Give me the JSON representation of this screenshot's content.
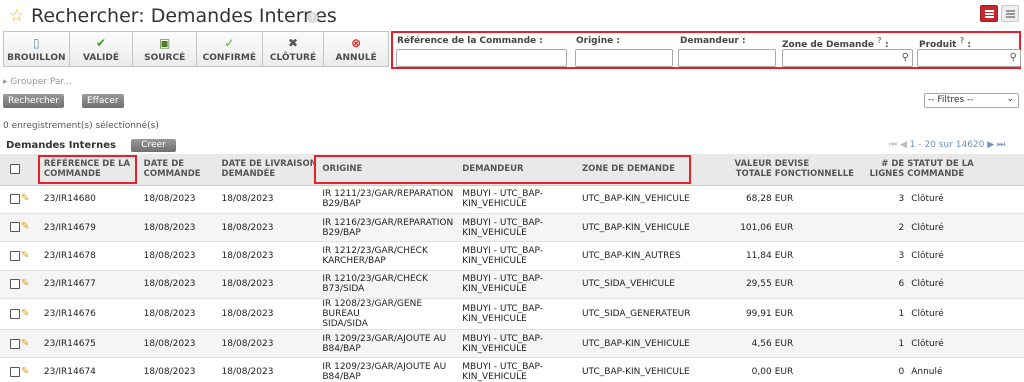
{
  "header": {
    "title": "Rechercher: Demandes Internes"
  },
  "states": [
    {
      "label": "BROUILLON",
      "icon": "draft-icon",
      "glyph": "▯",
      "color": "#6b8cb8"
    },
    {
      "label": "VALIDÉ",
      "icon": "check-circle-icon",
      "glyph": "✔",
      "color": "#3f9a2a"
    },
    {
      "label": "SOURCÉ",
      "icon": "source-icon",
      "glyph": "▣",
      "color": "#4a7d2a"
    },
    {
      "label": "CONFIRMÉ",
      "icon": "checkmark-icon",
      "glyph": "✓",
      "color": "#4caf28"
    },
    {
      "label": "CLÔTURÉ",
      "icon": "close-x-icon",
      "glyph": "✖",
      "color": "#555555"
    },
    {
      "label": "ANNULÉ",
      "icon": "cancel-circle-icon",
      "glyph": "⊗",
      "color": "#d32323"
    }
  ],
  "filters": {
    "reference_label": "Référence de la Commande :",
    "origin_label": "Origine :",
    "requester_label": "Demandeur :",
    "zone_label": "Zone de Demande",
    "product_label": "Produit",
    "help_mark": "?",
    "colon": ":",
    "reference_value": "",
    "origin_value": "",
    "requester_value": "",
    "zone_value": "",
    "product_value": ""
  },
  "toolbar": {
    "group_by": "Grouper Par...",
    "search_button": "Rechercher",
    "clear_button": "Effacer",
    "filters_select": "-- Filtres --",
    "selected_count": "0 enregistrement(s) sélectionné(s)"
  },
  "list": {
    "title": "Demandes Internes",
    "create_button": "Creer",
    "pager": "1 - 20 sur 14620"
  },
  "columns": {
    "reference": [
      "RÉFÉRENCE DE LA",
      "COMMANDE"
    ],
    "date": [
      "DATE DE",
      "COMMANDE"
    ],
    "delivery": [
      "DATE DE LIVRAISON",
      "DEMANDÉE"
    ],
    "origin": [
      "ORIGINE"
    ],
    "requester": [
      "DEMANDEUR"
    ],
    "zone": [
      "ZONE DE DEMANDE"
    ],
    "total": [
      "VALEUR",
      "TOTALE"
    ],
    "currency": [
      "DEVISE",
      "FONCTIONNELLE"
    ],
    "lines": [
      "# DE",
      "LIGNES"
    ],
    "status": [
      "STATUT DE LA",
      "COMMANDE"
    ]
  },
  "rows": [
    {
      "ref": "23/IR14680",
      "date": "18/08/2023",
      "delivery": "18/08/2023",
      "origin": [
        "IR 1211/23/GAR/REPARATION",
        "B29/BAP"
      ],
      "requester": [
        "MBUYI - UTC_BAP-",
        "KIN_VEHICULE"
      ],
      "zone": "UTC_BAP-KIN_VEHICULE",
      "total": "68,28",
      "currency": "EUR",
      "lines": "3",
      "status": "Clôturé"
    },
    {
      "ref": "23/IR14679",
      "date": "18/08/2023",
      "delivery": "18/08/2023",
      "origin": [
        "IR 1216/23/GAR/REPARATION",
        "B29/BAP"
      ],
      "requester": [
        "MBUYI - UTC_BAP-",
        "KIN_VEHICULE"
      ],
      "zone": "UTC_BAP-KIN_VEHICULE",
      "total": "101,06",
      "currency": "EUR",
      "lines": "2",
      "status": "Clôturé"
    },
    {
      "ref": "23/IR14678",
      "date": "18/08/2023",
      "delivery": "18/08/2023",
      "origin": [
        "IR 1212/23/GAR/CHECK",
        "KARCHER/BAP"
      ],
      "requester": [
        "MBUYI - UTC_BAP-",
        "KIN_VEHICULE"
      ],
      "zone": "UTC_BAP-KIN_AUTRES",
      "total": "11,84",
      "currency": "EUR",
      "lines": "3",
      "status": "Clôturé"
    },
    {
      "ref": "23/IR14677",
      "date": "18/08/2023",
      "delivery": "18/08/2023",
      "origin": [
        "IR 1210/23/GAR/CHECK",
        "B73/SIDA"
      ],
      "requester": [
        "MBUYI - UTC_BAP-",
        "KIN_VEHICULE"
      ],
      "zone": "UTC_SIDA_VEHICULE",
      "total": "29,55",
      "currency": "EUR",
      "lines": "6",
      "status": "Clôturé"
    },
    {
      "ref": "23/IR14676",
      "date": "18/08/2023",
      "delivery": "18/08/2023",
      "origin": [
        "IR 1208/23/GAR/GENE BUREAU",
        "SIDA/SIDA"
      ],
      "requester": [
        "MBUYI - UTC_BAP-",
        "KIN_VEHICULE"
      ],
      "zone": "UTC_SIDA_GENERATEUR",
      "total": "99,91",
      "currency": "EUR",
      "lines": "1",
      "status": "Clôturé"
    },
    {
      "ref": "23/IR14675",
      "date": "18/08/2023",
      "delivery": "18/08/2023",
      "origin": [
        "IR 1209/23/GAR/AJOUTE AU",
        "B84/BAP"
      ],
      "requester": [
        "MBUYI - UTC_BAP-",
        "KIN_VEHICULE"
      ],
      "zone": "UTC_BAP-KIN_VEHICULE",
      "total": "4,56",
      "currency": "EUR",
      "lines": "1",
      "status": "Clôturé"
    },
    {
      "ref": "23/IR14674",
      "date": "18/08/2023",
      "delivery": "18/08/2023",
      "origin": [
        "IR 1209/23/GAR/AJOUTE AU",
        "B84/BAP"
      ],
      "requester": [
        "MBUYI - UTC_BAP-",
        "KIN_VEHICULE"
      ],
      "zone": "UTC_BAP-KIN_VEHICULE",
      "total": "0,00",
      "currency": "EUR",
      "lines": "0",
      "status": "Annulé"
    }
  ]
}
